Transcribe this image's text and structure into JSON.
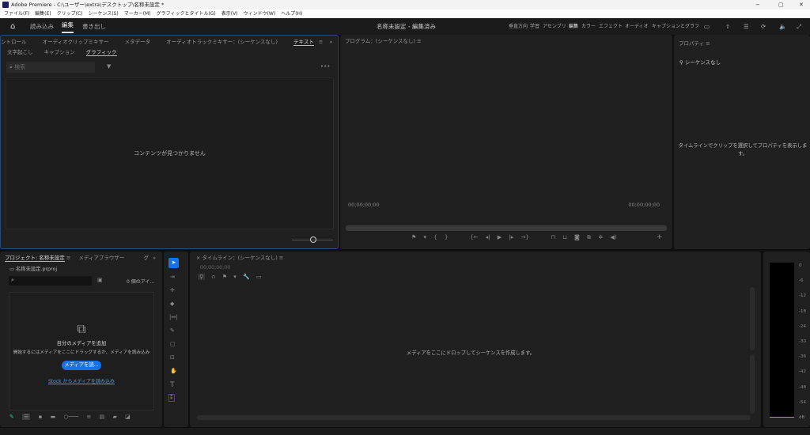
{
  "titlebar": {
    "title": "Adobe Premiere - C:\\ユーザー\\extra\\デスクトップ\\名称未設定 *",
    "minimize": "−",
    "maximize": "▢",
    "close": "✕"
  },
  "menu": [
    "ファイル(F)",
    "編集(E)",
    "クリップ(C)",
    "シーケンス(S)",
    "マーカー(M)",
    "グラフィックとタイトル(G)",
    "表示(V)",
    "ウィンドウ(W)",
    "ヘルプ(H)"
  ],
  "header": {
    "tabs": [
      "読み込み",
      "編集",
      "書き出し"
    ],
    "active_tab": "編集",
    "doc_title": "名称未設定 - 編集済み",
    "workspaces": [
      "垂直方向",
      "学習",
      "アセンブリ",
      "編集",
      "カラー",
      "エフェクト",
      "オーディオ",
      "キャプションとグラフ"
    ]
  },
  "top_left_panel": {
    "tabs": [
      "ントロール",
      "オーディオクリップミキサー",
      "メタデータ",
      "オーディオトラックミキサー：(シーケンスなし)",
      "テキスト"
    ],
    "subtabs": [
      "文字起こし",
      "キャプション",
      "グラフィック"
    ],
    "search_placeholder": "検索",
    "empty_message": "コンテンツが見つかりません"
  },
  "program": {
    "title": "プログラム：(シーケンスなし)",
    "timecode_left": "00;00;00;00",
    "timecode_right": "00;00;00;00"
  },
  "properties": {
    "title": "プロパティ",
    "sequence": "シーケンスなし",
    "hint": "タイムラインでクリップを選択してプロパティを表示します。"
  },
  "project": {
    "tabs": [
      "プロジェクト: 名称未設定",
      "メディアブラウザー",
      "グ"
    ],
    "file": "名称未設定.prproj",
    "item_count": "0 個のアイ...",
    "add_media_title": "自分のメディアを追加",
    "add_media_hint": "開始するにはメディアをここにドラッグするか、メディアを読み込み",
    "import_button": "メディアを読...",
    "stock_link": "Stock からメディアを読み込み"
  },
  "timeline": {
    "title": "タイムライン：(シーケンスなし)",
    "timecode": "00;00;00;00",
    "drop_message": "メディアをここにドロップしてシーケンスを作成します。"
  },
  "meter": {
    "labels": [
      "0",
      "-6",
      "-12",
      "-18",
      "-24",
      "-30",
      "-36",
      "-42",
      "-48",
      "-54",
      "dB"
    ]
  },
  "colors": {
    "accent": "#1473e6",
    "selected_tool": "#1473e6",
    "link": "#4a9ef0"
  }
}
